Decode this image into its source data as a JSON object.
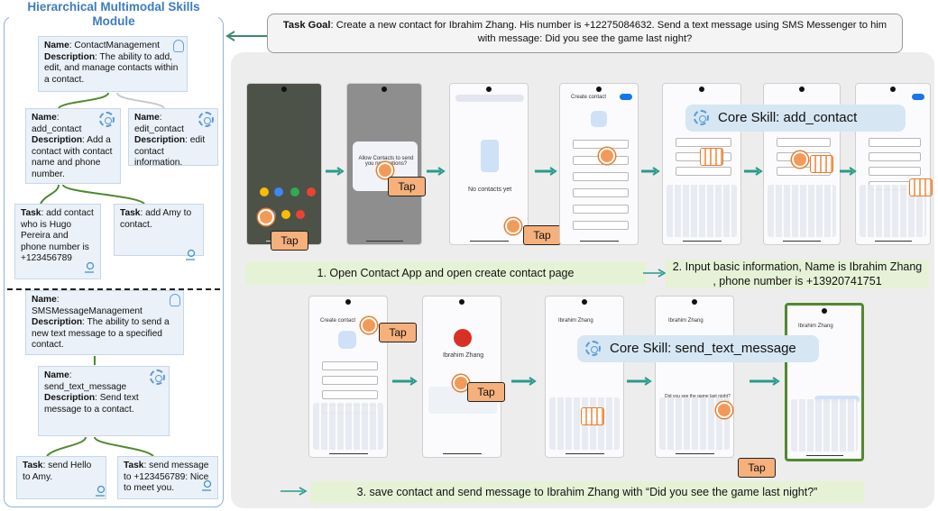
{
  "left_module": {
    "title": "Hierarchical Multimodal Skills Module",
    "contact": {
      "top": {
        "name_key": "Name",
        "name": "ContactManagement",
        "desc_key": "Description",
        "desc": "The ability to add, edit, and manage contacts within a contact."
      },
      "add": {
        "name_key": "Name",
        "name": "add_contact",
        "desc_key": "Description",
        "desc": "Add a contact with contact name and phone number."
      },
      "edit": {
        "name_key": "Name",
        "name": "edit_contact",
        "desc_key": "Description",
        "desc": "edit contact information."
      },
      "task1": {
        "key": "Task",
        "text": "add contact who is Hugo Pereira and phone number is +123456789"
      },
      "task2": {
        "key": "Task",
        "text": "add Amy to contact."
      }
    },
    "sms": {
      "top": {
        "name_key": "Name",
        "name": "SMSMessageManagement",
        "desc_key": "Description",
        "desc": "The ability to send a new text message to a specified contact."
      },
      "send": {
        "name_key": "Name",
        "name": "send_text_message",
        "desc_key": "Description",
        "desc": "Send text message to a contact."
      },
      "task1": {
        "key": "Task",
        "text": "send Hello to Amy."
      },
      "task2": {
        "key": "Task",
        "text": "send message to +123456789: Nice to meet you."
      }
    }
  },
  "goal": {
    "key": "Task Goal",
    "text": "Create a new contact for Ibrahim Zhang. His number is +12275084632. Send a text message using SMS Messenger to him with message: Did you see the game last night?"
  },
  "skills": {
    "add": "Core Skill: add_contact",
    "send": "Core Skill: send_text_message"
  },
  "steps": {
    "s1": "1. Open Contact App and open create contact page",
    "s2": "2. Input basic information, Name is Ibrahim Zhang , phone number is +13920741751",
    "s3": "3. save contact and send message to Ibrahim Zhang with “Did you see the game last night?”"
  },
  "tap": "Tap",
  "screens": {
    "allow": "Allow Contacts to send you notifications?",
    "no_contacts": "No contacts yet",
    "create_contact": "Create contact",
    "save": "Save",
    "contact_name": "Ibrahim Zhang",
    "chat_name": "Ibrahim Zhang",
    "message": "Did you see the game last night?"
  },
  "colors": {
    "accent_blue": "#3d7cc1",
    "tap_orange": "#f6b07b",
    "step_green": "#e5f2d6",
    "skill_blue": "#d6e6f3",
    "frame_green": "#4f8a2d"
  }
}
